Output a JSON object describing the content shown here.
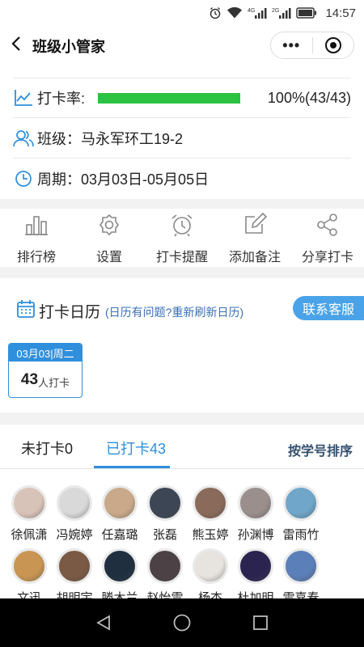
{
  "status_bar": {
    "time": "14:57",
    "net1": "4G",
    "net2": "2G"
  },
  "header": {
    "title": "班级小管家"
  },
  "stats": {
    "rate_label": "打卡率:",
    "rate_fraction": 1.0,
    "rate_text": "100%(43/43)",
    "class_label": "班级：",
    "class_name": "马永军环工19-2",
    "period_label": "周期：",
    "period_value": "03月03日-05月05日"
  },
  "actions": [
    {
      "label": "排行榜",
      "icon": "bar-chart-icon"
    },
    {
      "label": "设置",
      "icon": "gear-icon"
    },
    {
      "label": "打卡提醒",
      "icon": "alarm-clock-icon"
    },
    {
      "label": "添加备注",
      "icon": "edit-icon"
    },
    {
      "label": "分享打卡",
      "icon": "share-icon"
    }
  ],
  "calendar": {
    "title": "打卡日历",
    "hint": "(日历有问题?重新刷新日历)",
    "service_label": "联系客服",
    "day_header": "03月03|周二",
    "day_count": "43",
    "day_unit": "人打卡"
  },
  "tabs": {
    "unchecked": "未打卡0",
    "checked": "已打卡43",
    "sort": "按学号排序"
  },
  "members": [
    {
      "name": "徐佩潇",
      "color": "#d8c3b8"
    },
    {
      "name": "冯婉婷",
      "color": "#d9d9d9"
    },
    {
      "name": "任嘉璐",
      "color": "#c9a98a"
    },
    {
      "name": "张磊",
      "color": "#3d4654"
    },
    {
      "name": "熊玉婷",
      "color": "#8a6a5a"
    },
    {
      "name": "孙渊博",
      "color": "#9a8f8c"
    },
    {
      "name": "雷雨竹",
      "color": "#6fa6c9"
    },
    {
      "name": "文迅",
      "color": "#c89552"
    },
    {
      "name": "胡明宇",
      "color": "#7a5a44"
    },
    {
      "name": "滕木兰",
      "color": "#1f2f40"
    },
    {
      "name": "赵怡雪",
      "color": "#4c4246"
    },
    {
      "name": "杨杰",
      "color": "#e7e4df"
    },
    {
      "name": "杜加明",
      "color": "#2b2450"
    },
    {
      "name": "雷嘉春",
      "color": "#5b7fb8"
    }
  ],
  "colors": {
    "accent": "#2f8fdc",
    "progress": "#2bc340",
    "service_button": "#4aa3e8"
  }
}
